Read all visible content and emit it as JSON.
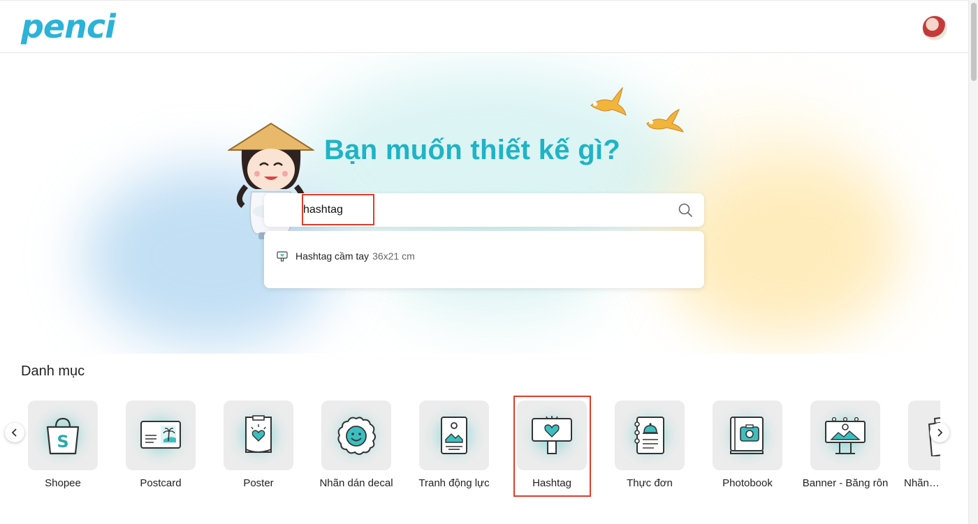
{
  "brand": {
    "logo_text": "penci"
  },
  "hero": {
    "title": "Bạn muốn thiết kế gì?",
    "search": {
      "value": "hashtag",
      "placeholder": ""
    },
    "suggestions": [
      {
        "name": "Hashtag cầm tay",
        "size": "36x21 cm"
      }
    ]
  },
  "categories": {
    "title": "Danh mục",
    "items": [
      {
        "label": "Shopee",
        "icon": "shopping-bag-icon"
      },
      {
        "label": "Postcard",
        "icon": "postcard-icon"
      },
      {
        "label": "Poster",
        "icon": "poster-icon"
      },
      {
        "label": "Nhãn dán decal",
        "icon": "sticker-icon"
      },
      {
        "label": "Tranh động lực",
        "icon": "frame-icon"
      },
      {
        "label": "Hashtag",
        "icon": "hashtag-sign-icon"
      },
      {
        "label": "Thực đơn",
        "icon": "menu-book-icon"
      },
      {
        "label": "Photobook",
        "icon": "photobook-icon"
      },
      {
        "label": "Banner - Băng rôn",
        "icon": "billboard-icon"
      },
      {
        "label": "Nhãn dán",
        "icon": "label-icon"
      }
    ]
  },
  "colors": {
    "accent": "#1fb3c6",
    "highlight": "#e03a2b",
    "icon_teal": "#3cbfc0"
  }
}
